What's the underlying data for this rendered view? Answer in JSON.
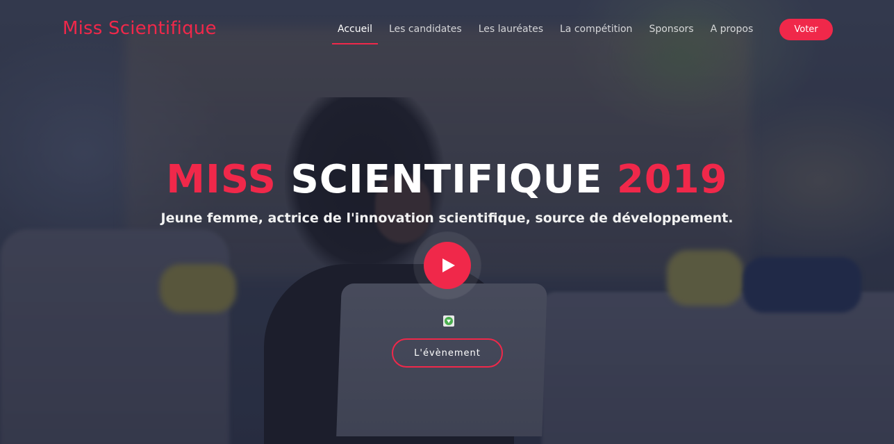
{
  "brand": {
    "name": "Miss Scientifique"
  },
  "nav": {
    "items": [
      {
        "label": "Accueil",
        "active": true
      },
      {
        "label": "Les candidates",
        "active": false
      },
      {
        "label": "Les lauréates",
        "active": false
      },
      {
        "label": "La compétition",
        "active": false
      },
      {
        "label": "Sponsors",
        "active": false
      },
      {
        "label": "A propos",
        "active": false
      }
    ],
    "cta_label": "Voter"
  },
  "hero": {
    "title_part1": "MISS",
    "title_part2": "SCIENTIFIQUE",
    "title_part3": "2019",
    "subtitle": "Jeune femme, actrice de l'innovation scientifique, source de développement.",
    "play_icon": "play-icon",
    "small_icon": "download-icon",
    "event_button_label": "L'évènement"
  },
  "colors": {
    "accent": "#f0284a",
    "text_light": "#ffffff",
    "overlay": "#181c30"
  }
}
